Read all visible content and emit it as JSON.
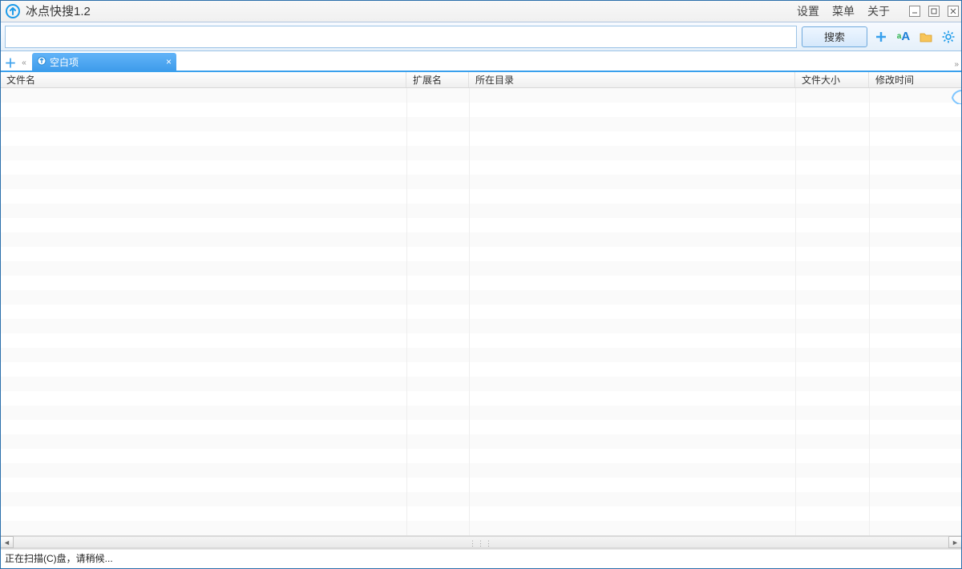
{
  "titlebar": {
    "title": "冰点快搜1.2",
    "menu": {
      "settings": "设置",
      "menu": "菜单",
      "about": "关于"
    }
  },
  "searchbar": {
    "value": "",
    "placeholder": "",
    "search_label": "搜索"
  },
  "tabbar": {
    "tabs": [
      {
        "label": "空白项"
      }
    ]
  },
  "columns": {
    "filename": "文件名",
    "ext": "扩展名",
    "dir": "所在目录",
    "size": "文件大小",
    "mtime": "修改时间"
  },
  "status": {
    "text": "正在扫描(C)盘，请稍候..."
  },
  "icons": {
    "plus": "＋",
    "font_small": "a",
    "font_large": "A",
    "close_x": "×",
    "scroll_left": "«",
    "scroll_right": "»",
    "tri_left": "◄",
    "tri_right": "►",
    "grip": "⋮⋮⋮"
  },
  "colors": {
    "accent": "#39a0ed",
    "green": "#2bb24c",
    "orange": "#f5a623"
  }
}
